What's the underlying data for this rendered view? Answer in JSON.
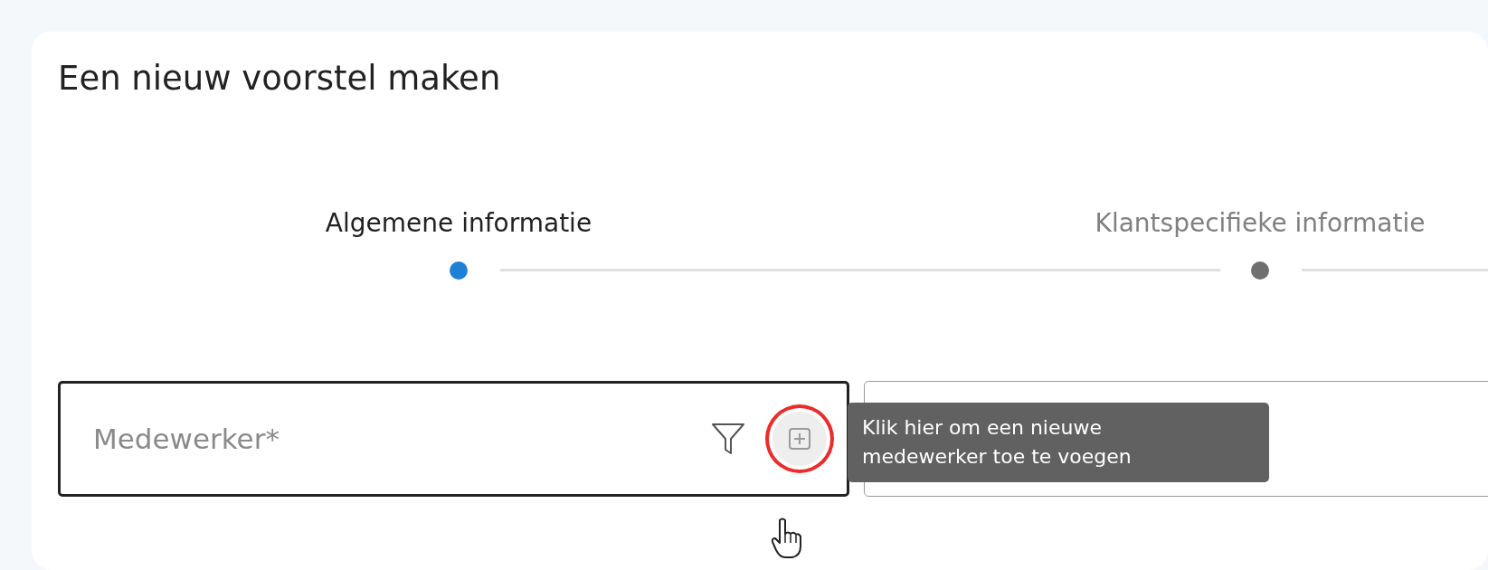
{
  "page": {
    "title": "Een nieuw voorstel maken"
  },
  "steps": [
    {
      "label": "Algemene informatie",
      "selected": true
    },
    {
      "label": "Klantspecifieke informatie",
      "selected": false
    }
  ],
  "fields": [
    {
      "kind": "lookup",
      "placeholder": "Medewerker*",
      "focused": true,
      "add_button": {
        "highlighted": true
      },
      "tooltip": "Klik hier om een nieuwe medewerker toe te voegen"
    },
    {
      "kind": "text",
      "focused": false
    }
  ]
}
